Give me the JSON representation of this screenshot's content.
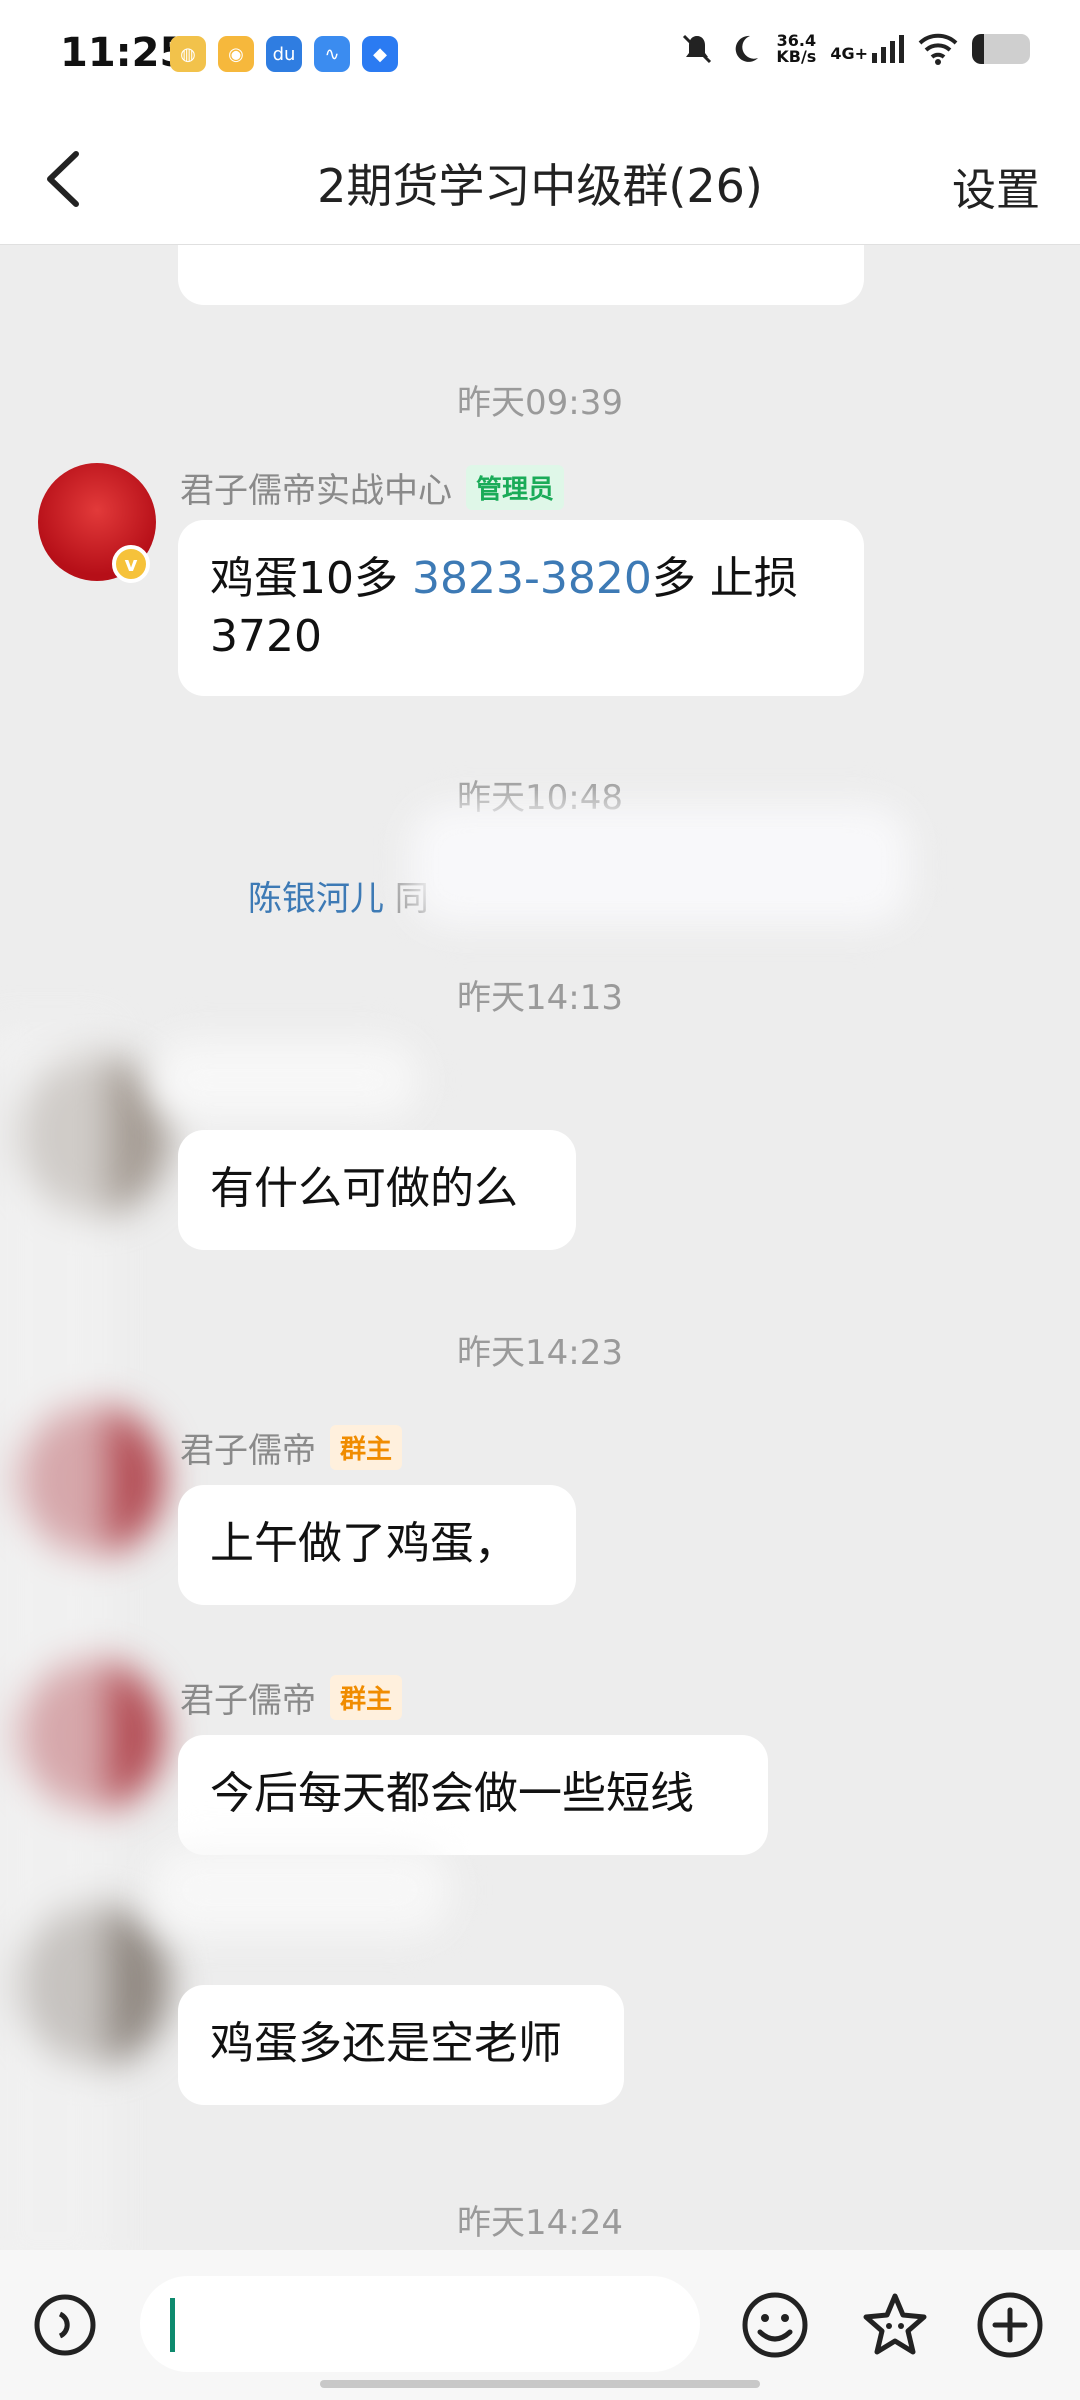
{
  "status_bar": {
    "time": "11:25",
    "net_speed": "36.4",
    "net_unit": "KB/s",
    "signal": "4G+",
    "battery_level": 0.2
  },
  "header": {
    "title": "2期货学习中级群(26)",
    "settings_label": "设置"
  },
  "messages": {
    "time_1": "昨天09:39",
    "sender_1": "君子儒帝实战中心",
    "badge_admin": "管理员",
    "msg_1_a": "鸡蛋10多  ",
    "msg_1_link": "3823-3820",
    "msg_1_b": "多  止损3720",
    "time_2": "昨天10:48",
    "system_name": "陈银河儿",
    "system_rest": " 同",
    "time_3": "昨天14:13",
    "msg_2": "有什么可做的么",
    "time_4": "昨天14:23",
    "sender_2": "君子儒帝",
    "badge_owner": "群主",
    "msg_3": "上午做了鸡蛋，",
    "sender_3": "君子儒帝",
    "msg_4": "今后每天都会做一些短线",
    "msg_5": "鸡蛋多还是空老师",
    "time_5": "昨天14:24"
  },
  "input": {
    "value": "",
    "placeholder": ""
  },
  "icons": {
    "back": "chevron-left-icon",
    "emoji": "emoji-icon",
    "sticker": "sticker-icon",
    "plus": "plus-icon"
  },
  "colors": {
    "admin_badge": "#1aab58",
    "owner_badge": "#f08c00",
    "link": "#3d7ab5",
    "caret": "#0e8a6e"
  }
}
